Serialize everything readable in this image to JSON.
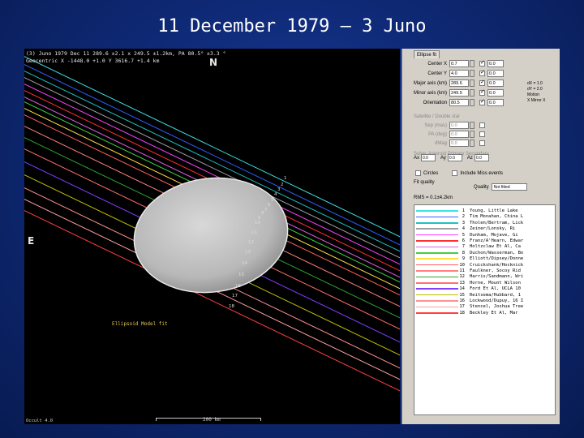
{
  "slide": {
    "title": "11 December 1979 – 3 Juno"
  },
  "plot": {
    "header_line1": "(3) Juno  1979 Dec 11  289.6 ±2.1 x 249.5 ±1.2km, PA 80.5° ±3.3 °",
    "header_line2": "Geocentric X -1448.0 +1.0  Y 3616.7 +1.4 km",
    "north_label": "N",
    "east_label": "E",
    "axis_note": "Ellipsoid Model fit",
    "scale_label": "200 km",
    "footer_left": "Occult 4.0",
    "chord_labels": [
      "1",
      "2",
      "3",
      "4",
      "5",
      "6",
      "7",
      "8",
      "9",
      "10",
      "11",
      "12",
      "13",
      "14",
      "15",
      "16",
      "17",
      "18"
    ]
  },
  "panel": {
    "tab_label": "Ellipse fit",
    "rows": [
      {
        "label": "Center X",
        "value": "0.7",
        "checked": true,
        "extra": "0.0"
      },
      {
        "label": "Center Y",
        "value": "4.0",
        "checked": true,
        "extra": "0.0"
      },
      {
        "label": "Major axis (km)",
        "value": "289.6",
        "checked": true,
        "extra": "0.0"
      },
      {
        "label": "Minor axis (km)",
        "value": "249.5",
        "checked": true,
        "extra": "0.0"
      },
      {
        "label": "Orientation",
        "value": "80.5",
        "checked": true,
        "extra": "0.0"
      }
    ],
    "side_info": [
      "dX = 1.0",
      "dY = 2.0",
      "Motion",
      "X Mirror X"
    ],
    "dim_section_label": "Satellite / Double star",
    "dim_rows": [
      {
        "label": "Sep (mas)",
        "value": "0.0"
      },
      {
        "label": "PA (deg)",
        "value": "0.0"
      },
      {
        "label": "dMag",
        "value": "0.0"
      }
    ],
    "star_options": "Solve: Asteroid  Primary  Secondary",
    "triplet": [
      {
        "label": "Ax",
        "value": "0.0"
      },
      {
        "label": "Ay",
        "value": "0.0"
      },
      {
        "label": "Az",
        "value": "0.0"
      }
    ],
    "circle_label": "Circle",
    "checkbox_a": "Circles",
    "checkbox_b": "Include Miss events",
    "fit_label": "Fit quality",
    "quality_label": "Quality",
    "quality_value": "Not fitted",
    "rms_label": "RMS = 0.1±4.2km",
    "chords": [
      {
        "num": "1",
        "color": "#40e0e0",
        "observer": "Young, Little Lake"
      },
      {
        "num": "2",
        "color": "#3060ff",
        "observer": "Tim Monahan, China L"
      },
      {
        "num": "3",
        "color": "#20c0c0",
        "observer": "Tholen/Bertram, Lick"
      },
      {
        "num": "4",
        "color": "#a0a0a0",
        "observer": "Zeiner/Lonsky, Ri"
      },
      {
        "num": "5",
        "color": "#ff40ff",
        "observer": "Dunham, Mojave, Gi"
      },
      {
        "num": "6",
        "color": "#ff3030",
        "observer": "Franz/A'Hearn, Edwar"
      },
      {
        "num": "7",
        "color": "#e060e0",
        "observer": "Holtzclaw Et Al, Ca"
      },
      {
        "num": "8",
        "color": "#40d040",
        "observer": "Duchon/Wasserman, Bo"
      },
      {
        "num": "9",
        "color": "#ffe040",
        "observer": "Elliott/Dipsey/Donne"
      },
      {
        "num": "10",
        "color": "#ff6060",
        "observer": "Cruickshank/Hocknick"
      },
      {
        "num": "11",
        "color": "#ff8080",
        "observer": "Faulkner, Socoy Rid"
      },
      {
        "num": "12",
        "color": "#30a030",
        "observer": "Harris/Sandmann, Wri"
      },
      {
        "num": "13",
        "color": "#ff7070",
        "observer": "Horne, Mount Wilson"
      },
      {
        "num": "14",
        "color": "#8040ff",
        "observer": "Ford Et Al, UCLA 10"
      },
      {
        "num": "15",
        "color": "#c0c000",
        "observer": "Reitsema/Hubbard, 1"
      },
      {
        "num": "16",
        "color": "#ff9090",
        "observer": "Lockwood/Dupuy, 16 I"
      },
      {
        "num": "17",
        "color": "#ffa0a0",
        "observer": "Stencel, Joshua Tree"
      },
      {
        "num": "18",
        "color": "#ff4040",
        "observer": "Beckley Et Al, Mar"
      }
    ]
  }
}
